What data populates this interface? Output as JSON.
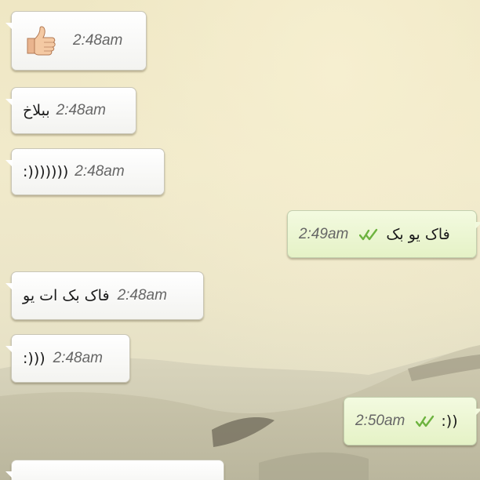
{
  "messages": [
    {
      "direction": "incoming",
      "content_icon": "thumbs-up-icon",
      "time": "2:48am"
    },
    {
      "direction": "incoming",
      "text": "ببلاخ",
      "time": "2:48am"
    },
    {
      "direction": "incoming",
      "text": ":)))))))",
      "time": "2:48am"
    },
    {
      "direction": "outgoing",
      "text": "فاک یو بک",
      "time": "2:49am",
      "status_icon": "double-check-icon"
    },
    {
      "direction": "incoming",
      "text": "فاک بک ات یو",
      "time": "2:48am"
    },
    {
      "direction": "incoming",
      "text": ":)))",
      "time": "2:48am"
    },
    {
      "direction": "outgoing",
      "text": ":))",
      "time": "2:50am",
      "status_icon": "double-check-icon"
    }
  ],
  "colors": {
    "read_ticks": "#6db33f",
    "incoming_bubble": "#ffffff",
    "outgoing_bubble": "#e8f4cc",
    "time_text": "#666666"
  }
}
